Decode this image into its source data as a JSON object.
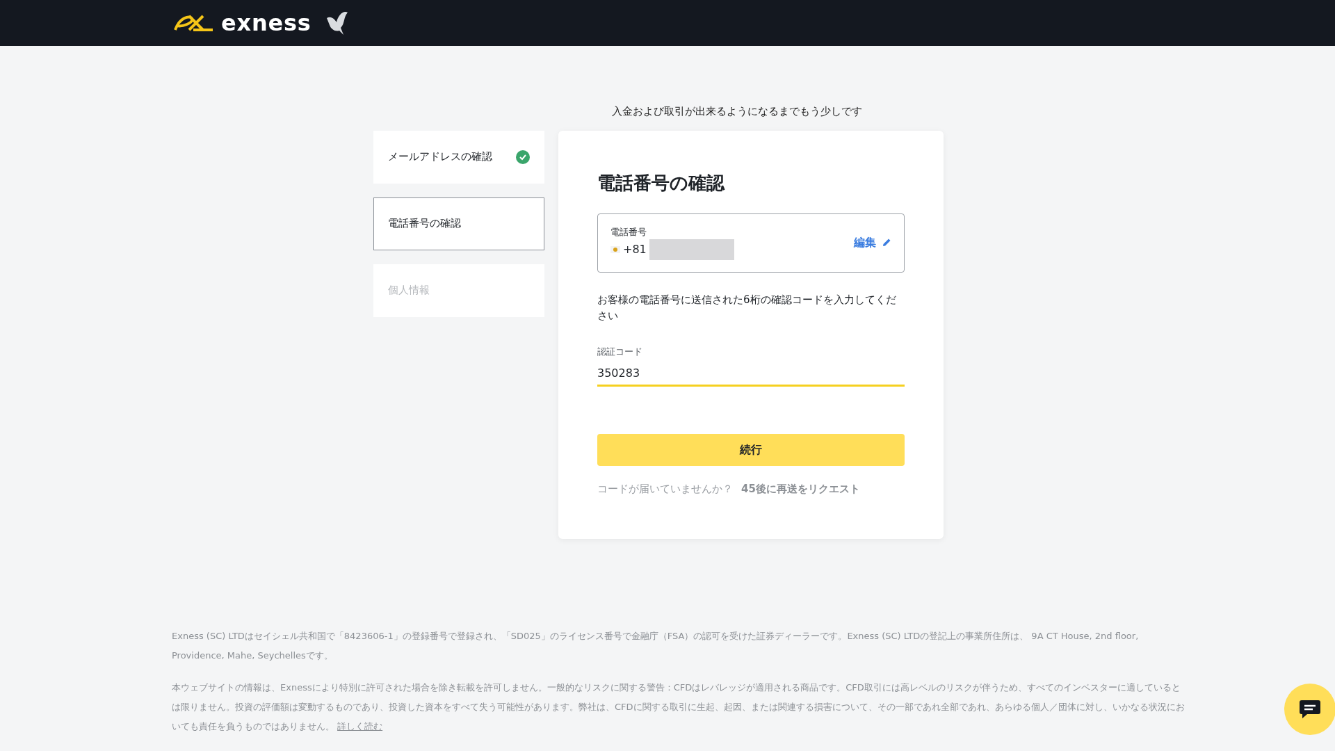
{
  "header": {
    "logo_text": "exness"
  },
  "subtitle": "入金および取引が出来るようになるまでもう少しです",
  "steps": [
    {
      "label": "メールアドレスの確認",
      "selected": false,
      "completed": true,
      "disabled": false
    },
    {
      "label": "電話番号の確認",
      "selected": true,
      "completed": false,
      "disabled": false
    },
    {
      "label": "個人情報",
      "selected": false,
      "completed": false,
      "disabled": true
    }
  ],
  "card": {
    "title": "電話番号の確認",
    "phone": {
      "label": "電話番号",
      "prefix": "+81",
      "edit": "編集"
    },
    "instruction": "お客様の電話番号に送信された6桁の確認コードを入力してください",
    "code_field": {
      "label": "認証コード",
      "value": "350283"
    },
    "continue_button": "続行",
    "resend_question": "コードが届いていませんか？",
    "resend_link": "45後に再送をリクエスト"
  },
  "footer": {
    "paragraphs": [
      "Exness (SC) LTDはセイシェル共和国で「8423606-1」の登録番号で登録され、「SD025」のライセンス番号で金融庁（FSA）の認可を受けた証券ディーラーです。Exness (SC) LTDの登記上の事業所住所は、 9A CT House, 2nd floor, Providence, Mahe, Seychellesです。",
      "本ウェブサイトの情報は、Exnessにより特別に許可された場合を除き転載を許可しません。一般的なリスクに関する警告：CFDはレバレッジが適用される商品です。CFD取引には高レベルのリスクが伴うため、すべてのインベスターに適しているとは限りません。投資の評価額は変動するものであり、投資した資本をすべて失う可能性があります。弊社は、CFDに関する取引に生起、起因、または関連する損害について、その一部であれ全部であれ、あらゆる個人／団体に対し、いかなる状況においても責任を負うものではありません。"
    ],
    "read_more": "詳しく読む"
  }
}
